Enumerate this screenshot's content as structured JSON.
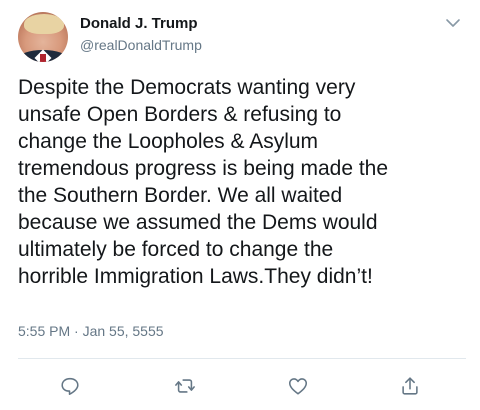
{
  "author": {
    "name": "Donald J. Trump",
    "handle": "@realDonaldTrump",
    "avatar_icon": "avatar-portrait"
  },
  "tweet": {
    "text": "Despite the Democrats wanting very\nunsafe Open Borders & refusing to\nchange the Loopholes & Asylum\ntremendous progress is being made the\nthe Southern Border. We all waited\nbecause we assumed the Dems would\nultimately be forced to change the\nhorrible Immigration Laws.They didn’t!",
    "timestamp": "5:55 PM · Jan 55, 5555"
  },
  "actions": [
    {
      "name": "reply",
      "icon": "reply-icon"
    },
    {
      "name": "retweet",
      "icon": "retweet-icon"
    },
    {
      "name": "like",
      "icon": "heart-icon"
    },
    {
      "name": "share",
      "icon": "share-icon"
    }
  ],
  "colors": {
    "text_primary": "#14171a",
    "text_secondary": "#657786",
    "divider": "#e1e8ed",
    "background": "#ffffff"
  }
}
